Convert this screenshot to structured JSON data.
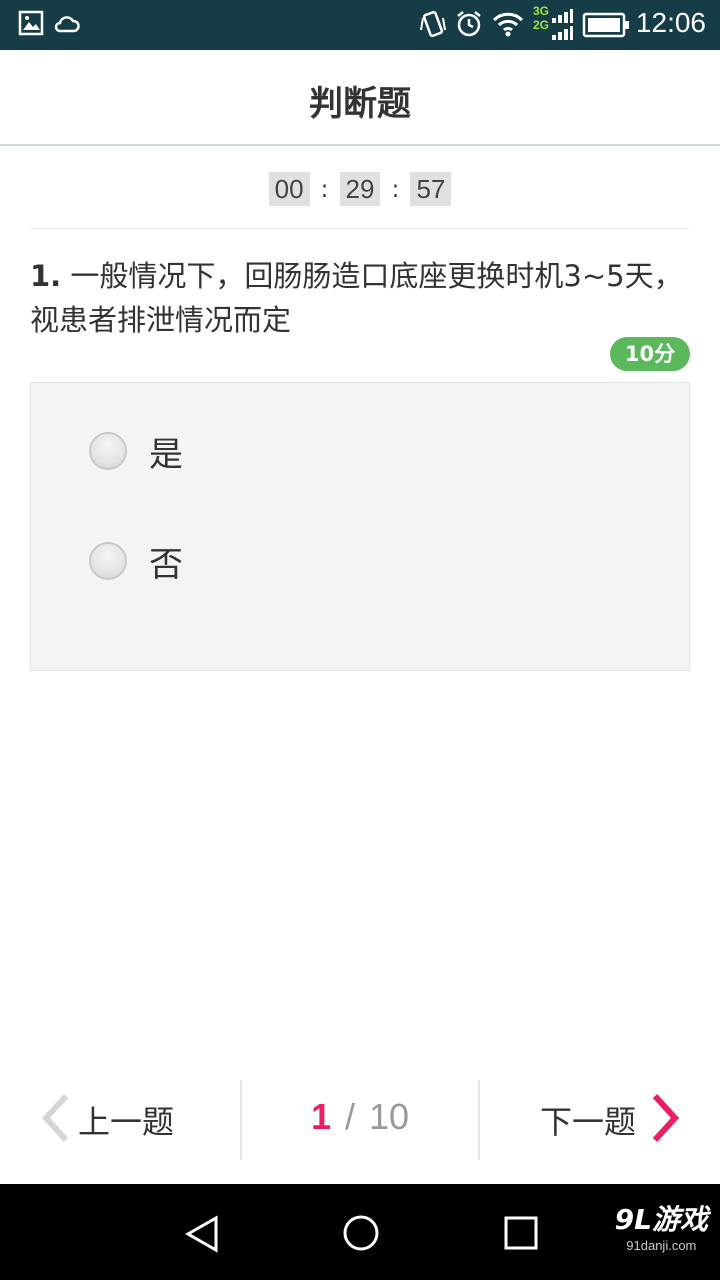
{
  "status_bar": {
    "time": "12:06",
    "network_top": "3G",
    "network_bottom": "2G",
    "icons": [
      "image-icon",
      "cloud-icon",
      "vibrate-icon",
      "alarm-icon",
      "wifi-icon",
      "signal-icon",
      "battery-icon"
    ]
  },
  "header": {
    "title": "判断题"
  },
  "timer": {
    "hours": "00",
    "minutes": "29",
    "seconds": "57",
    "separator": ":"
  },
  "question": {
    "number": "1.",
    "text": " 一般情况下，回肠肠造口底座更换时机3~5天，视患者排泄情况而定",
    "score": "10分"
  },
  "options": [
    {
      "label": "是",
      "selected": false
    },
    {
      "label": "否",
      "selected": false
    }
  ],
  "footer": {
    "prev_label": "上一题",
    "next_label": "下一题",
    "current": "1",
    "separator": "/",
    "total": "10"
  },
  "watermark": {
    "main": "9L游戏",
    "sub": "91danji.com"
  },
  "colors": {
    "accent": "#e91e63",
    "score_badge": "#5cb85c",
    "status_bar": "#163c47"
  }
}
